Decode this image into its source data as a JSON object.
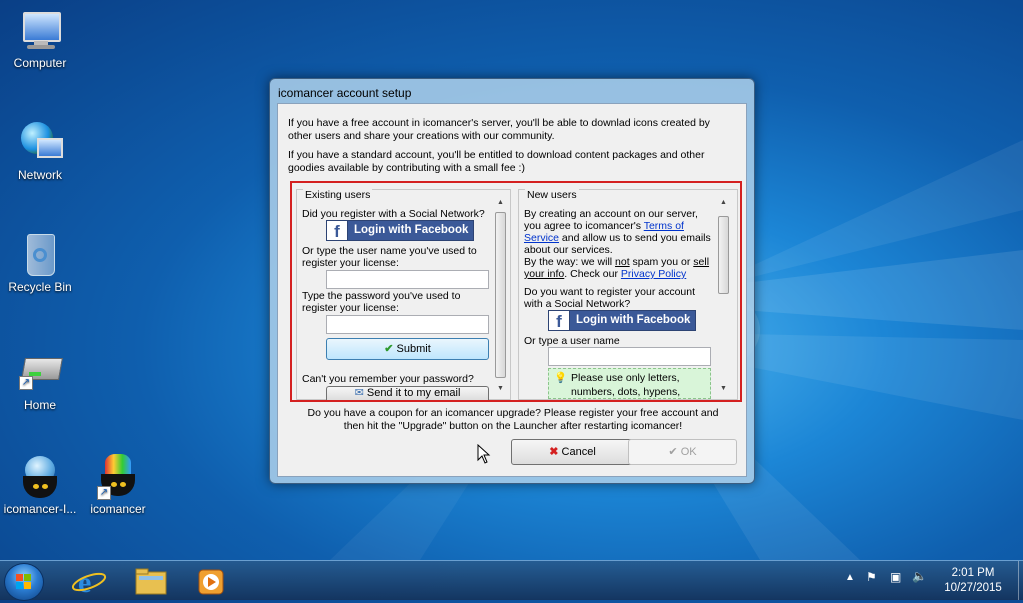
{
  "desktop": {
    "icons": [
      {
        "label": "Computer",
        "icon": "computer-icon"
      },
      {
        "label": "Network",
        "icon": "network-icon"
      },
      {
        "label": "Recycle Bin",
        "icon": "recycle-bin-icon"
      },
      {
        "label": "Home",
        "icon": "home-drive-icon"
      },
      {
        "label": "icomancer-I...",
        "icon": "icomancer-cauldron-icon"
      },
      {
        "label": "icomancer",
        "icon": "icomancer-shortcut-icon"
      }
    ]
  },
  "dialog": {
    "title": "icomancer account setup",
    "intro1": "If you have a free account in icomancer's server, you'll be able to downlad icons created by other users and share your creations with our community.",
    "intro2": "If you have a standard account, you'll be entitled to download content packages and other goodies available by contributing with a small fee :)",
    "existing": {
      "title": "Existing users",
      "social_q": "Did you register with a Social Network?",
      "fb_label": "Login with Facebook",
      "username_prompt": "Or type the user name you've used to register your license:",
      "username_value": "",
      "password_prompt": "Type the password you've used to register your license:",
      "password_value": "",
      "submit_label": "Submit",
      "forgot_q": "Can't you remember your password?",
      "send_label": "Send it to my email"
    },
    "newusers": {
      "title": "New users",
      "terms_pre": "By creating an account on our server, you agree to icomancer's ",
      "terms_link": "Terms of Service",
      "terms_post": " and allow us to send you emails about our services.",
      "spam_pre": "By the way: we will ",
      "spam_not": "not",
      "spam_mid": " spam you or ",
      "spam_sell": "sell your info",
      "spam_mid2": ". Check our ",
      "privacy_link": "Privacy Policy",
      "social_q": "Do you want to register your account with a Social Network?",
      "fb_label": "Login with Facebook",
      "username_prompt": "Or type a user name",
      "username_value": "",
      "hint": "Please use only letters, numbers, dots, hypens,"
    },
    "coupon": "Do you have a coupon for an icomancer upgrade? Please register your free account and then hit the \"Upgrade\" button on the Launcher after restarting icomancer!",
    "cancel_label": "Cancel",
    "ok_label": "OK"
  },
  "taskbar": {
    "pinned": [
      "internet-explorer-icon",
      "file-explorer-icon",
      "media-player-icon"
    ],
    "time": "2:01 PM",
    "date": "10/27/2015"
  },
  "colors": {
    "highlight_border": "#d42020",
    "facebook": "#3b5998",
    "link": "#0033cc"
  }
}
